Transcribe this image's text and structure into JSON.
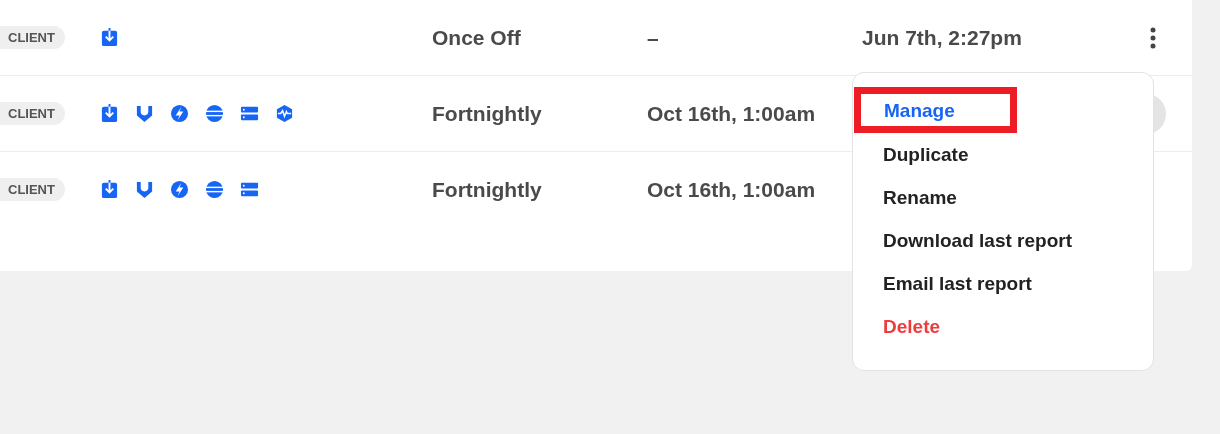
{
  "rows": [
    {
      "badge": "CLIENT",
      "icons": [
        {
          "kind": "download"
        }
      ],
      "frequency": "Once Off",
      "next_run": "–",
      "last_run": "Jun 7th, 2:27pm",
      "menu_open": false
    },
    {
      "badge": "CLIENT",
      "icons": [
        {
          "kind": "download"
        },
        {
          "kind": "shield"
        },
        {
          "kind": "bolt"
        },
        {
          "kind": "globe"
        },
        {
          "kind": "server"
        },
        {
          "kind": "pulse"
        }
      ],
      "frequency": "Fortnightly",
      "next_run": "Oct 16th, 1:00am",
      "menu_open": true
    },
    {
      "badge": "CLIENT",
      "icons": [
        {
          "kind": "download"
        },
        {
          "kind": "shield"
        },
        {
          "kind": "bolt"
        },
        {
          "kind": "globe"
        },
        {
          "kind": "server"
        }
      ],
      "frequency": "Fortnightly",
      "next_run": "Oct 16th, 1:00am",
      "menu_open": false
    }
  ],
  "menu": [
    {
      "label": "Manage",
      "kind": "primary",
      "highlighted": true
    },
    {
      "label": "Duplicate",
      "kind": "default",
      "highlighted": false
    },
    {
      "label": "Rename",
      "kind": "default",
      "highlighted": false
    },
    {
      "label": "Download last report",
      "kind": "default",
      "highlighted": false
    },
    {
      "label": "Email last report",
      "kind": "default",
      "highlighted": false
    },
    {
      "label": "Delete",
      "kind": "danger",
      "highlighted": false
    }
  ]
}
